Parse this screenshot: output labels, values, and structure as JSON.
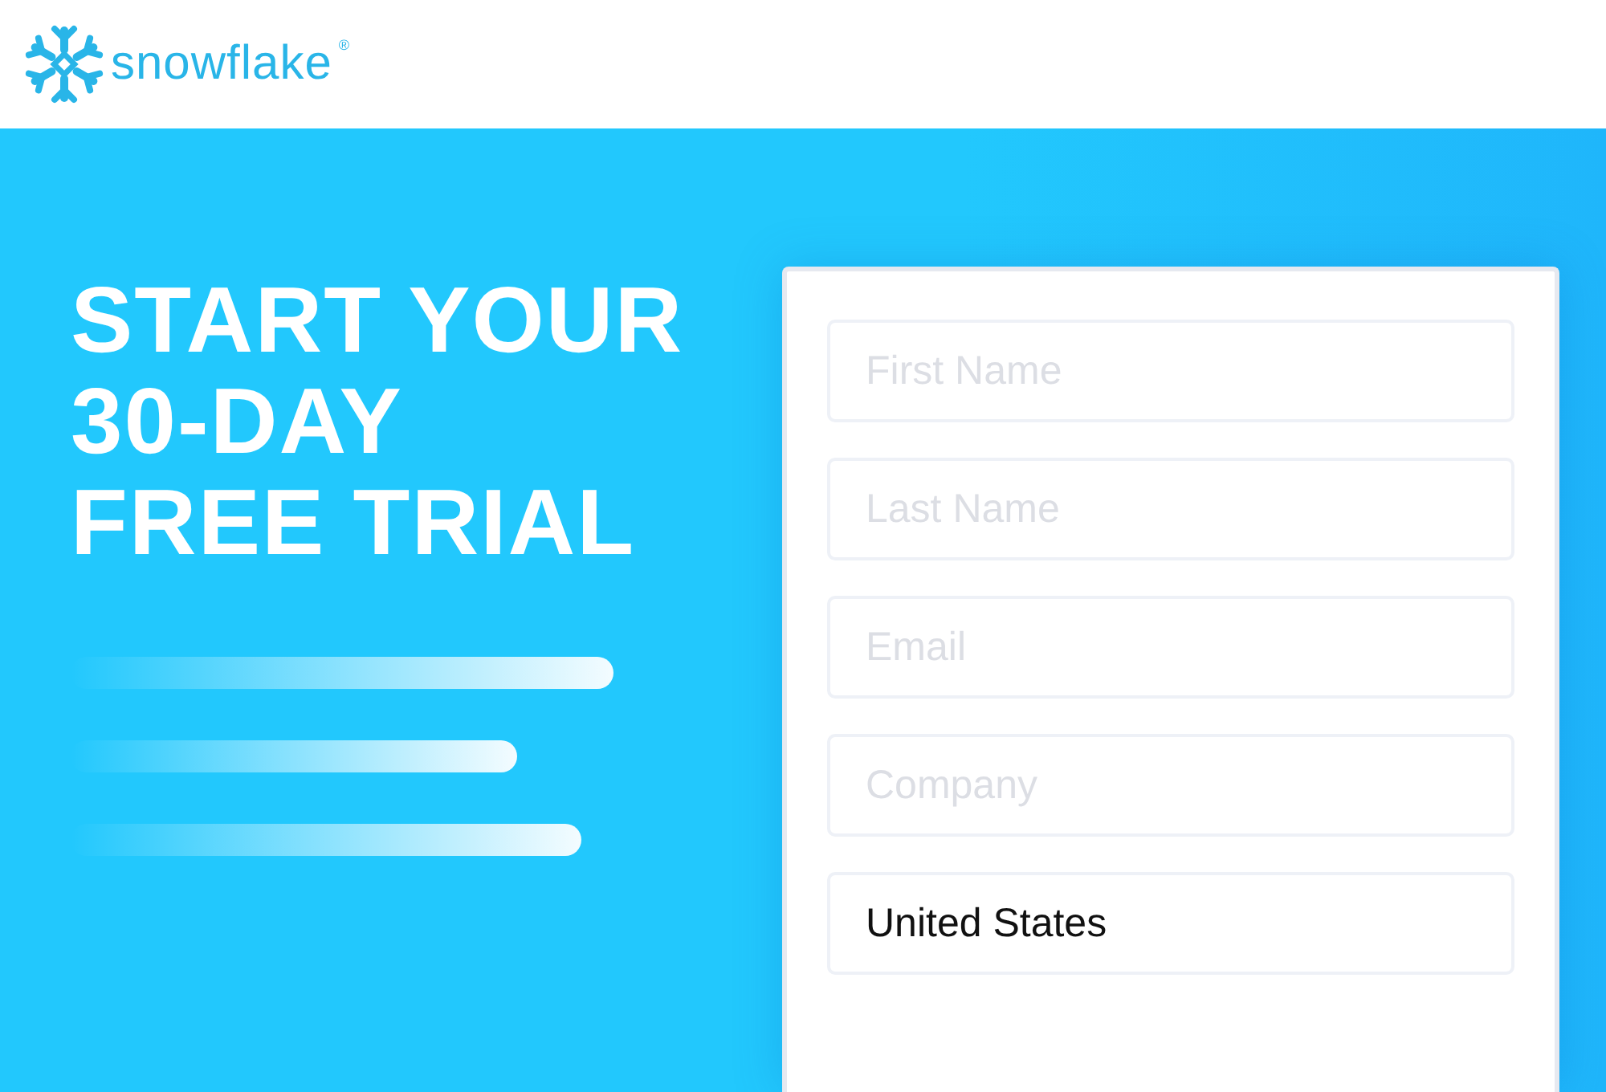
{
  "logo": {
    "wordmark": "snowflake",
    "mark": "®"
  },
  "headline": {
    "lines": [
      "START YOUR",
      "30-DAY",
      "FREE TRIAL"
    ]
  },
  "form": {
    "fields": [
      {
        "kind": "text",
        "placeholder": "First Name"
      },
      {
        "kind": "text",
        "placeholder": "Last Name"
      },
      {
        "kind": "text",
        "placeholder": "Email"
      },
      {
        "kind": "text",
        "placeholder": "Company"
      },
      {
        "kind": "select",
        "value": "United States"
      }
    ]
  }
}
